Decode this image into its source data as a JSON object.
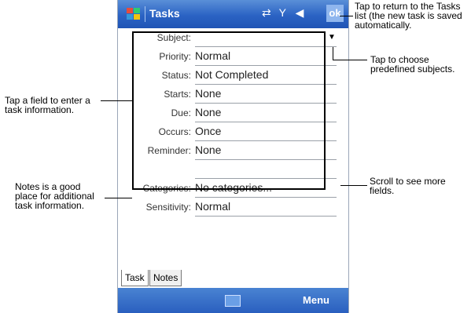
{
  "app": {
    "title": "Tasks",
    "ok": "ok"
  },
  "fields": [
    {
      "label": "Subject:",
      "value": ""
    },
    {
      "label": "Priority:",
      "value": "Normal"
    },
    {
      "label": "Status:",
      "value": "Not Completed"
    },
    {
      "label": "Starts:",
      "value": "None"
    },
    {
      "label": "Due:",
      "value": "None"
    },
    {
      "label": "Occurs:",
      "value": "Once"
    },
    {
      "label": "Reminder:",
      "value": "None"
    },
    {
      "label": "",
      "value": ""
    },
    {
      "label": "Categories:",
      "value": "No categories..."
    },
    {
      "label": "Sensitivity:",
      "value": "Normal"
    }
  ],
  "tabs": [
    "Task",
    "Notes"
  ],
  "bottom": {
    "menu": "Menu"
  },
  "callouts": {
    "ok": "Tap to return to the Tasks list (the new task is saved automatically.",
    "subject": "Tap to choose predefined subjects.",
    "field": "Tap a field to enter a task information.",
    "notes": "Notes is a good place for additional task information.",
    "scroll": "Scroll to see more fields."
  }
}
